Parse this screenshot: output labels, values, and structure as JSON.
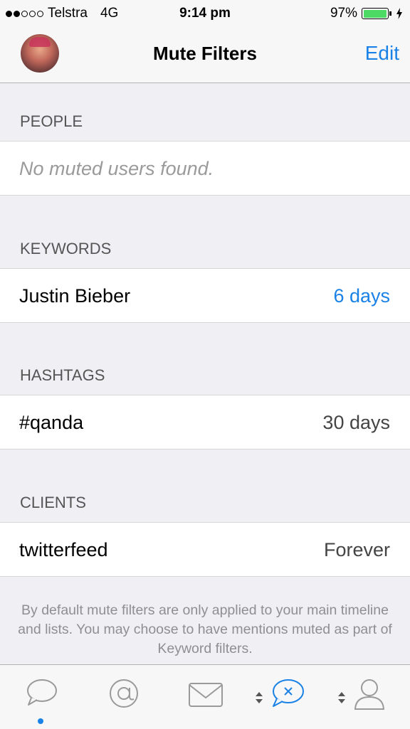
{
  "status_bar": {
    "carrier": "Telstra",
    "network": "4G",
    "time": "9:14 pm",
    "battery": "97%",
    "battery_level": 0.97,
    "signal_bars_filled": 2,
    "signal_bars_total": 5
  },
  "nav": {
    "title": "Mute Filters",
    "edit_label": "Edit"
  },
  "sections": {
    "people": {
      "header": "PEOPLE",
      "empty_text": "No muted users found."
    },
    "keywords": {
      "header": "KEYWORDS",
      "items": [
        {
          "label": "Justin Bieber",
          "duration": "6 days"
        }
      ]
    },
    "hashtags": {
      "header": "HASHTAGS",
      "items": [
        {
          "label": "#qanda",
          "duration": "30 days"
        }
      ]
    },
    "clients": {
      "header": "CLIENTS",
      "items": [
        {
          "label": "twitterfeed",
          "duration": "Forever"
        }
      ]
    }
  },
  "footer_note": "By default mute filters are only applied to your main timeline and lists. You may choose to have mentions muted as part of Keyword filters.",
  "tab_bar": {
    "tabs": [
      {
        "icon": "speech-bubble-icon"
      },
      {
        "icon": "at-sign-icon"
      },
      {
        "icon": "envelope-icon"
      },
      {
        "icon": "mute-bubble-icon"
      },
      {
        "icon": "person-icon"
      }
    ]
  },
  "colors": {
    "accent": "#1a82e6",
    "battery": "#4cd964",
    "background": "#efeff4"
  }
}
